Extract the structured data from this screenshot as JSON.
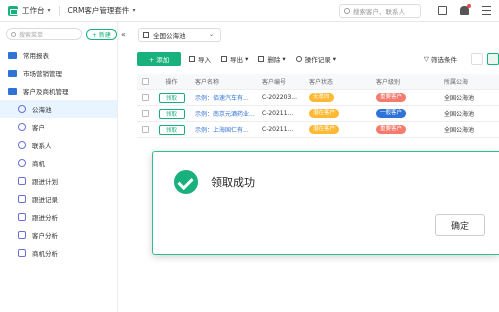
{
  "topbar": {
    "app_title": "工作台",
    "suite_title": "CRM客户管理套件",
    "search_placeholder": "搜索客户、联系人"
  },
  "sidebar": {
    "search_placeholder": "搜索菜单",
    "new_label": "+ 新建",
    "collapse_glyph": "«",
    "folders": [
      {
        "label": "常用报表"
      },
      {
        "label": "市场营销管理"
      },
      {
        "label": "客户及商机管理"
      }
    ],
    "items": [
      {
        "label": "公海池",
        "icon": "users-icon",
        "active": true
      },
      {
        "label": "客户",
        "icon": "user-icon"
      },
      {
        "label": "联系人",
        "icon": "contact-icon"
      },
      {
        "label": "商机",
        "icon": "target-icon"
      },
      {
        "label": "跟进计划",
        "icon": "plan-icon"
      },
      {
        "label": "跟进记录",
        "icon": "record-icon"
      },
      {
        "label": "跟进分析",
        "icon": "chart-icon"
      },
      {
        "label": "客户分析",
        "icon": "chart-icon"
      },
      {
        "label": "商机分析",
        "icon": "chart-icon"
      }
    ]
  },
  "main": {
    "pool_select": "全国公海池",
    "toolbar": {
      "add": "+ 添加",
      "import": "导入",
      "export": "导出",
      "delete": "删除",
      "oplog": "操作记录",
      "filter": "筛选条件"
    },
    "table": {
      "headers": [
        "操作",
        "客户名称",
        "客户编号",
        "客户状态",
        "客户级别",
        "所属公海"
      ],
      "rows": [
        {
          "action": "领取",
          "name": "示例：佰速汽车有...",
          "code": "C-202203...",
          "status": "无意向",
          "status_color": "#fdb933",
          "level": "重要客户",
          "level_color": "#f47b6e",
          "pool": "全国公海池"
        },
        {
          "action": "领取",
          "name": "示例：南京元酒药业...",
          "code": "C-20211...",
          "status": "潜在客户",
          "status_color": "#fdb933",
          "level": "一般客户",
          "level_color": "#2f73d9",
          "pool": "全国公海池"
        },
        {
          "action": "领取",
          "name": "示例：上海国仁有...",
          "code": "C-20211...",
          "status": "潜在客户",
          "status_color": "#fdb933",
          "level": "重要客户",
          "level_color": "#f47b6e",
          "pool": "全国公海池"
        }
      ]
    }
  },
  "dialog": {
    "message": "领取成功",
    "confirm": "确定"
  },
  "colors": {
    "brand": "#18b07c",
    "active_bg": "#e8f4ff"
  }
}
